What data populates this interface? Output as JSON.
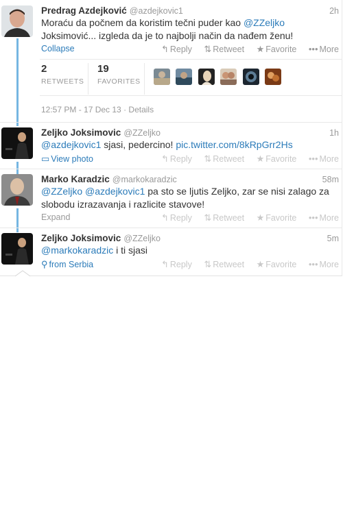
{
  "tweets": [
    {
      "name": "Predrag Azdejković",
      "handle": "@azdejkovic1",
      "time": "2h",
      "text_a": "Moraću da počnem da koristim tečni puder kao ",
      "mention": "@ZZeljko",
      "text_b": "Joksimović... izgleda da je to najbolji način da nađem ženu!",
      "footer": "Collapse"
    },
    {
      "name": "Zeljko Joksimovic",
      "handle": "@ZZeljko",
      "time": "1h",
      "mention": "@azdejkovic1",
      "text": " sjasi, pedercino! ",
      "link": "pic.twitter.com/8kRpGrr2Hs",
      "footer": "View photo"
    },
    {
      "name": "Marko Karadzic",
      "handle": "@markokaradzic",
      "time": "58m",
      "mention1": "@ZZeljko",
      "mention2": "@azdejkovic1",
      "text": " pa sto se ljutis Zeljko, zar se nisi zalago za slobodu izrazavanja i razlicite stavove!",
      "footer": "Expand"
    },
    {
      "name": "Zeljko Joksimovic",
      "handle": "@ZZeljko",
      "time": "5m",
      "mention": "@markokaradzic",
      "text": " i ti sjasi",
      "footer": "from Serbia"
    }
  ],
  "actions": {
    "reply": "Reply",
    "retweet": "Retweet",
    "favorite": "Favorite",
    "more": "More"
  },
  "stats": {
    "retweets_count": "2",
    "retweets_label": "RETWEETS",
    "favorites_count": "19",
    "favorites_label": "FAVORITES"
  },
  "timestamp": "12:57 PM - 17 Dec 13",
  "details": "Details",
  "icons": [
    "reply-icon",
    "retweet-icon",
    "star-icon",
    "more-dots-icon",
    "photo-icon",
    "location-pin-icon"
  ],
  "colors": {
    "link": "#2b7bb9",
    "thread_line": "#5ea9dd",
    "muted": "#999999"
  }
}
